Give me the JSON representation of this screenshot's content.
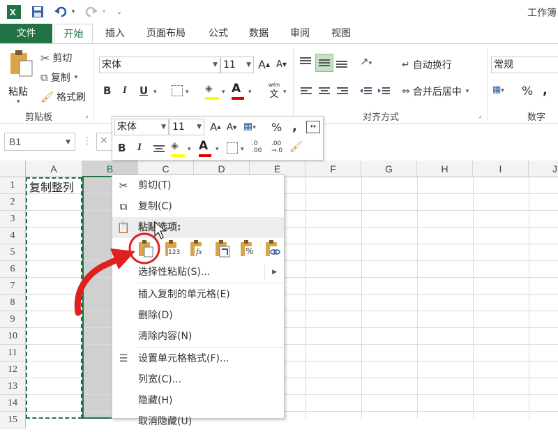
{
  "titlebar": {
    "title": "工作簿",
    "icons": [
      "excel-logo",
      "save-icon",
      "undo-icon",
      "redo-icon",
      "customize-qat-icon"
    ]
  },
  "tabs": [
    "文件",
    "开始",
    "插入",
    "页面布局",
    "公式",
    "数据",
    "审阅",
    "视图"
  ],
  "active_tab": "开始",
  "ribbon": {
    "clipboard": {
      "paste": "粘贴",
      "cut": "剪切",
      "copy": "复制",
      "format_painter": "格式刷",
      "group": "剪贴板"
    },
    "font": {
      "name": "宋体",
      "size": "11",
      "bold": "B",
      "italic": "I",
      "underline": "U",
      "font_color": "A",
      "wen": "wén",
      "wen_char": "文",
      "group": "字体"
    },
    "alignment": {
      "wrap": "自动换行",
      "merge": "合并后居中",
      "group": "对齐方式"
    },
    "number": {
      "format": "常规",
      "percent": "%",
      "group": "数字"
    }
  },
  "formula_bar": {
    "name_box": "B1",
    "fx_partial": "✕"
  },
  "mini_toolbar": {
    "font": "宋体",
    "size": "11",
    "percent": "%",
    "comma": ",",
    "bold": "B",
    "italic": "I",
    "font_color": "A",
    "inc_decimal": ".0\n.00",
    "dec_decimal": ".00\n→.0"
  },
  "sheet": {
    "columns": [
      "A",
      "B",
      "C",
      "D",
      "E",
      "F",
      "G",
      "H",
      "I",
      "J"
    ],
    "rows": [
      "1",
      "2",
      "3",
      "4",
      "5",
      "6",
      "7",
      "8",
      "9",
      "10",
      "11",
      "12",
      "13",
      "14",
      "15"
    ],
    "cell_a1": "复制整列",
    "selected_column": "B",
    "colors": {
      "header_bg": "#f3f3f3",
      "selected_col": "#d0d0d0",
      "accent": "#217346"
    }
  },
  "context_menu": {
    "cut": "剪切(T)",
    "copy": "复制(C)",
    "paste_options": "粘贴选项:",
    "paste_special": "选择性粘贴(S)...",
    "insert_copied": "插入复制的单元格(E)",
    "delete": "删除(D)",
    "clear": "清除内容(N)",
    "format_cells": "设置单元格格式(F)...",
    "col_width": "列宽(C)...",
    "hide": "隐藏(H)",
    "unhide": "取消隐藏(U)",
    "paste_icons": [
      "paste-icon",
      "paste-values-icon",
      "paste-formulas-icon",
      "paste-transpose-icon",
      "paste-formatting-icon",
      "paste-link-icon"
    ],
    "paste_icon_labels": [
      "",
      "123",
      "fx",
      "",
      "%",
      ""
    ]
  },
  "annotation": {
    "color": "#e02020"
  }
}
